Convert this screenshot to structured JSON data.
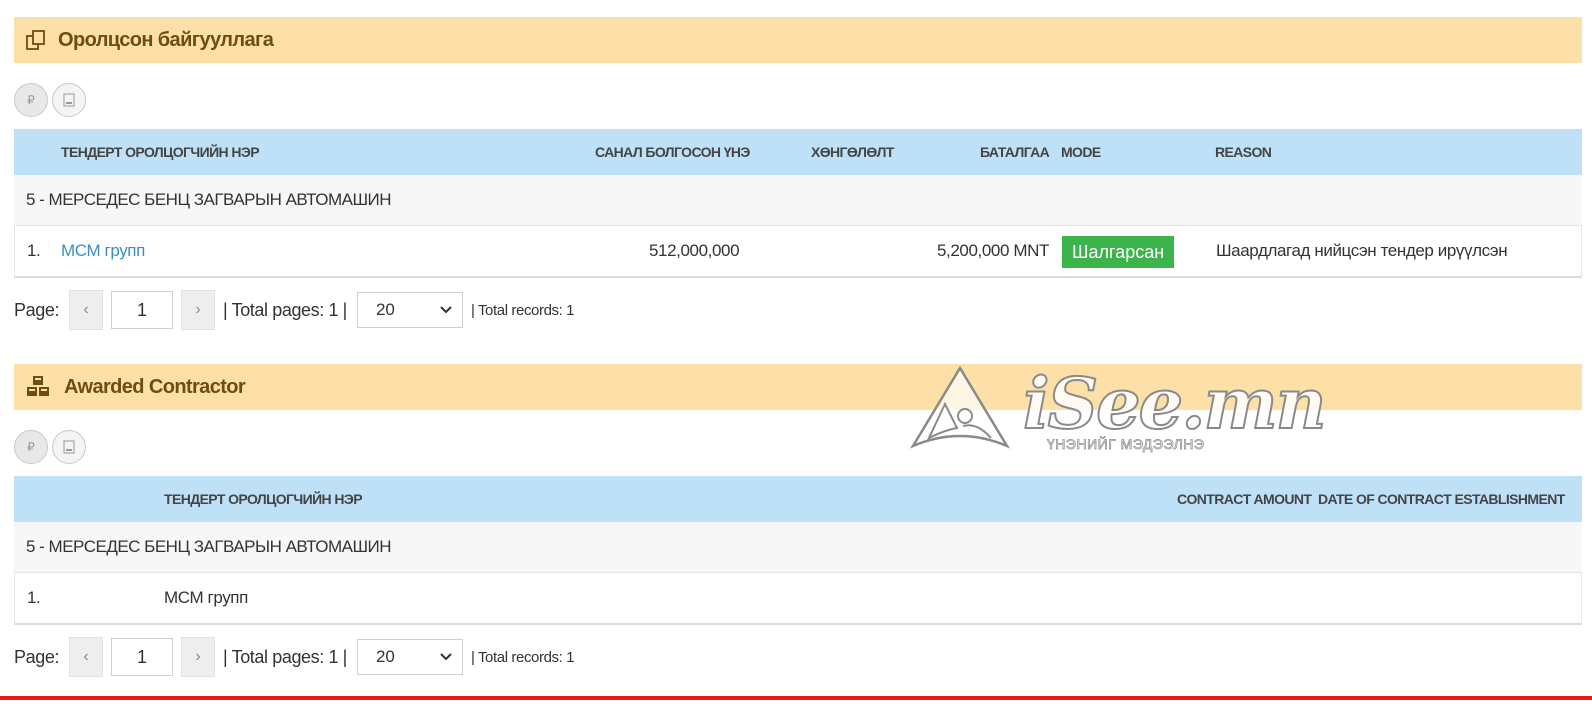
{
  "participants": {
    "header_title": "Оролцсон байгууллага",
    "columns": {
      "name": "ТЕНДЕРТ ОРОЛЦОГЧИЙН НЭР",
      "price": "САНАЛ БОЛГОСОН ҮНЭ",
      "discount": "ХӨНГӨЛӨЛТ",
      "guarantee": "БАТАЛГАА",
      "mode": "MODE",
      "reason": "REASON"
    },
    "group_label": "5 - МЕРСЕДЕС БЕНЦ ЗАГВАРЫН АВТОМАШИН",
    "rows": [
      {
        "index": "1.",
        "name": "МСМ групп",
        "price": "512,000,000",
        "guarantee": "5,200,000 MNT",
        "mode": "Шалгарсан",
        "reason": "Шаардлагад нийцсэн тендер ирүүлсэн"
      }
    ],
    "pagination": {
      "page_label": "Page:",
      "prev": "‹",
      "current": "1",
      "next": "›",
      "total_pages": "| Total pages: 1 |",
      "per_page": "20",
      "total_records": "| Total records: 1"
    }
  },
  "awarded": {
    "header_title": "Awarded Contractor",
    "columns": {
      "name": "ТЕНДЕРТ ОРОЛЦОГЧИЙН НЭР",
      "amount": "CONTRACT AMOUNT",
      "date": "DATE OF CONTRACT ESTABLISHMENT"
    },
    "group_label": "5 - МЕРСЕДЕС БЕНЦ ЗАГВАРЫН АВТОМАШИН",
    "rows": [
      {
        "index": "1.",
        "name": "МСМ групп"
      }
    ],
    "pagination": {
      "page_label": "Page:",
      "prev": "‹",
      "current": "1",
      "next": "›",
      "total_pages": "| Total pages: 1 |",
      "per_page": "20",
      "total_records": "| Total records: 1"
    }
  },
  "watermark": {
    "brand": "iSee.mn",
    "tagline": "ҮНЭНИЙГ МЭДЭЭЛНЭ"
  },
  "colors": {
    "section_header_bg": "#fce0a8",
    "table_header_bg": "#bfe1f7",
    "mode_badge_bg": "#3cb44b",
    "link": "#3a8fc8",
    "bottom_line": "#e41b17"
  },
  "icons": [
    "copy-icon",
    "cubes-icon",
    "pdf-icon",
    "excel-icon",
    "chevron-left-icon",
    "chevron-right-icon",
    "chevron-down-icon"
  ]
}
